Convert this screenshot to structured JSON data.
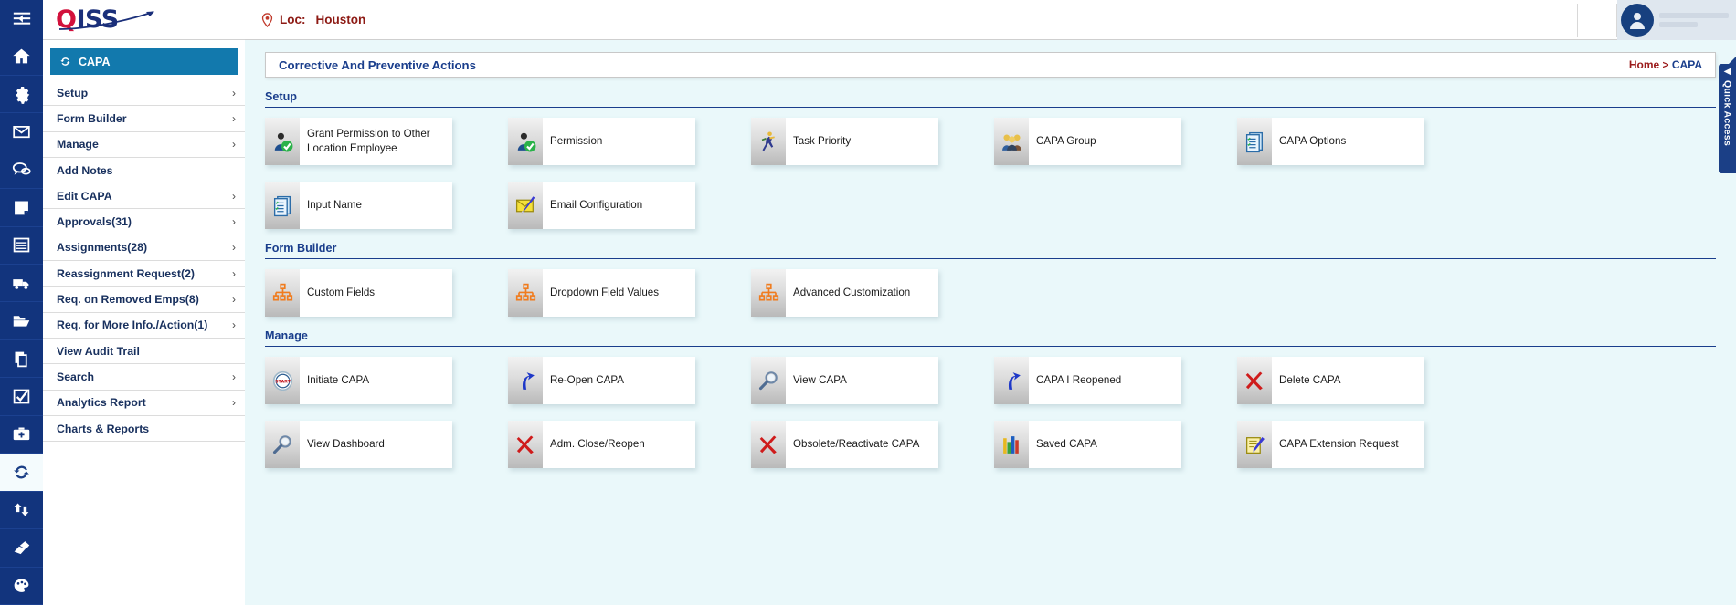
{
  "brand": {
    "logo_q": "Q",
    "logo_iss": "ISS",
    "accent_red": "#d2113c",
    "accent_navy": "#1a2f7a"
  },
  "topbar": {
    "hamburger_icon": "menu-collapse-icon",
    "location_pin_icon": "location-pin-icon",
    "location_label": "Loc:",
    "location_value": "Houston",
    "avatar_icon": "user-avatar-icon"
  },
  "rail": {
    "items": [
      {
        "icon": "home-icon",
        "name": "home"
      },
      {
        "icon": "gear-icon",
        "name": "settings"
      },
      {
        "icon": "envelope-icon",
        "name": "mail"
      },
      {
        "icon": "chat-bubbles-icon",
        "name": "chat"
      },
      {
        "icon": "note-icon",
        "name": "notes"
      },
      {
        "icon": "table-icon",
        "name": "records"
      },
      {
        "icon": "truck-icon",
        "name": "shipping"
      },
      {
        "icon": "folder-icon",
        "name": "documents"
      },
      {
        "icon": "copy-docs-icon",
        "name": "copies"
      },
      {
        "icon": "checkbox-icon",
        "name": "tasks"
      },
      {
        "icon": "first-aid-kit-icon",
        "name": "safety"
      },
      {
        "icon": "refresh-capa-icon",
        "name": "capa",
        "active": true
      },
      {
        "icon": "retweet-icon",
        "name": "transfers"
      },
      {
        "icon": "eraser-icon",
        "name": "eraser"
      },
      {
        "icon": "palette-icon",
        "name": "appearance"
      }
    ]
  },
  "sidebar": {
    "active_item": {
      "label": "CAPA",
      "icon": "refresh-icon"
    },
    "items": [
      {
        "label": "Setup",
        "chevron": true
      },
      {
        "label": "Form Builder",
        "chevron": true
      },
      {
        "label": "Manage",
        "chevron": true
      },
      {
        "label": "Add Notes",
        "chevron": false
      },
      {
        "label": "Edit CAPA",
        "chevron": true
      },
      {
        "label": "Approvals(31)",
        "chevron": true
      },
      {
        "label": "Assignments(28)",
        "chevron": true
      },
      {
        "label": "Reassignment Request(2)",
        "chevron": true
      },
      {
        "label": "Req. on Removed Emps(8)",
        "chevron": true
      },
      {
        "label": "Req. for More Info./Action(1)",
        "chevron": true
      },
      {
        "label": "View Audit Trail",
        "chevron": false
      },
      {
        "label": "Search",
        "chevron": true
      },
      {
        "label": "Analytics Report",
        "chevron": true
      },
      {
        "label": "Charts & Reports",
        "chevron": false
      }
    ]
  },
  "page": {
    "title": "Corrective And Preventive Actions",
    "breadcrumb": {
      "home": "Home",
      "separator": ">",
      "current": "CAPA"
    }
  },
  "sections": [
    {
      "title": "Setup",
      "cards": [
        {
          "label": "Grant Permission to Other Location Employee",
          "icon": "user-approved-icon"
        },
        {
          "label": "Permission",
          "icon": "user-approved-icon"
        },
        {
          "label": "Task Priority",
          "icon": "running-person-icon"
        },
        {
          "label": "CAPA Group",
          "icon": "user-group-icon"
        },
        {
          "label": "CAPA Options",
          "icon": "document-list-icon"
        },
        {
          "label": "Input Name",
          "icon": "document-list-icon"
        },
        {
          "label": "Email Configuration",
          "icon": "email-pencil-icon"
        }
      ]
    },
    {
      "title": "Form Builder",
      "cards": [
        {
          "label": "Custom Fields",
          "icon": "sitemap-icon"
        },
        {
          "label": "Dropdown Field Values",
          "icon": "sitemap-icon"
        },
        {
          "label": "Advanced Customization",
          "icon": "sitemap-icon"
        }
      ]
    },
    {
      "title": "Manage",
      "cards": [
        {
          "label": "Initiate CAPA",
          "icon": "start-badge-icon"
        },
        {
          "label": "Re-Open CAPA",
          "icon": "blue-curved-arrow-icon"
        },
        {
          "label": "View CAPA",
          "icon": "magnifier-icon"
        },
        {
          "label": "CAPA I Reopened",
          "icon": "blue-curved-arrow-icon"
        },
        {
          "label": "Delete CAPA",
          "icon": "red-x-icon"
        },
        {
          "label": "View Dashboard",
          "icon": "magnifier-icon"
        },
        {
          "label": "Adm. Close/Reopen",
          "icon": "red-x-icon"
        },
        {
          "label": "Obsolete/Reactivate CAPA",
          "icon": "red-x-icon"
        },
        {
          "label": "Saved CAPA",
          "icon": "bar-chart-icon"
        },
        {
          "label": "CAPA Extension Request",
          "icon": "edit-note-icon"
        }
      ]
    }
  ],
  "quick_access": {
    "label": "Quick Access",
    "arrow": "◀"
  }
}
